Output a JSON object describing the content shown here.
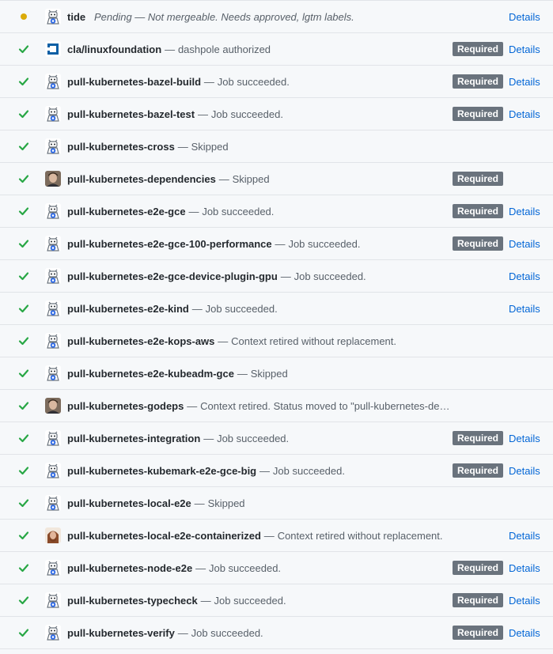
{
  "checks": [
    {
      "status": "pending",
      "avatar": "bot",
      "context": "tide",
      "separator": "",
      "description": "Pending — Not mergeable. Needs approved, lgtm labels.",
      "italic": true,
      "required": false,
      "details": "Details"
    },
    {
      "status": "success",
      "avatar": "linuxfoundation",
      "context": "cla/linuxfoundation",
      "separator": "—",
      "description": "dashpole authorized",
      "italic": false,
      "required": true,
      "details": "Details"
    },
    {
      "status": "success",
      "avatar": "bot",
      "context": "pull-kubernetes-bazel-build",
      "separator": "—",
      "description": "Job succeeded.",
      "italic": false,
      "required": true,
      "details": "Details"
    },
    {
      "status": "success",
      "avatar": "bot",
      "context": "pull-kubernetes-bazel-test",
      "separator": "—",
      "description": "Job succeeded.",
      "italic": false,
      "required": true,
      "details": "Details"
    },
    {
      "status": "success",
      "avatar": "bot",
      "context": "pull-kubernetes-cross",
      "separator": "—",
      "description": "Skipped",
      "italic": false,
      "required": false,
      "details": ""
    },
    {
      "status": "success",
      "avatar": "person1",
      "context": "pull-kubernetes-dependencies",
      "separator": "—",
      "description": "Skipped",
      "italic": false,
      "required": true,
      "details": ""
    },
    {
      "status": "success",
      "avatar": "bot",
      "context": "pull-kubernetes-e2e-gce",
      "separator": "—",
      "description": "Job succeeded.",
      "italic": false,
      "required": true,
      "details": "Details"
    },
    {
      "status": "success",
      "avatar": "bot",
      "context": "pull-kubernetes-e2e-gce-100-performance",
      "separator": "—",
      "description": "Job succeeded.",
      "italic": false,
      "required": true,
      "details": "Details"
    },
    {
      "status": "success",
      "avatar": "bot",
      "context": "pull-kubernetes-e2e-gce-device-plugin-gpu",
      "separator": "—",
      "description": "Job succeeded.",
      "italic": false,
      "required": false,
      "details": "Details"
    },
    {
      "status": "success",
      "avatar": "bot",
      "context": "pull-kubernetes-e2e-kind",
      "separator": "—",
      "description": "Job succeeded.",
      "italic": false,
      "required": false,
      "details": "Details"
    },
    {
      "status": "success",
      "avatar": "bot",
      "context": "pull-kubernetes-e2e-kops-aws",
      "separator": "—",
      "description": "Context retired without replacement.",
      "italic": false,
      "required": false,
      "details": ""
    },
    {
      "status": "success",
      "avatar": "bot",
      "context": "pull-kubernetes-e2e-kubeadm-gce",
      "separator": "—",
      "description": "Skipped",
      "italic": false,
      "required": false,
      "details": ""
    },
    {
      "status": "success",
      "avatar": "person1",
      "context": "pull-kubernetes-godeps",
      "separator": "—",
      "description": "Context retired. Status moved to \"pull-kubernetes-de…",
      "italic": false,
      "required": false,
      "details": ""
    },
    {
      "status": "success",
      "avatar": "bot",
      "context": "pull-kubernetes-integration",
      "separator": "—",
      "description": "Job succeeded.",
      "italic": false,
      "required": true,
      "details": "Details"
    },
    {
      "status": "success",
      "avatar": "bot",
      "context": "pull-kubernetes-kubemark-e2e-gce-big",
      "separator": "—",
      "description": "Job succeeded.",
      "italic": false,
      "required": true,
      "details": "Details"
    },
    {
      "status": "success",
      "avatar": "bot",
      "context": "pull-kubernetes-local-e2e",
      "separator": "—",
      "description": "Skipped",
      "italic": false,
      "required": false,
      "details": ""
    },
    {
      "status": "success",
      "avatar": "person2",
      "context": "pull-kubernetes-local-e2e-containerized",
      "separator": "—",
      "description": "Context retired without replacement.",
      "italic": false,
      "required": false,
      "details": "Details"
    },
    {
      "status": "success",
      "avatar": "bot",
      "context": "pull-kubernetes-node-e2e",
      "separator": "—",
      "description": "Job succeeded.",
      "italic": false,
      "required": true,
      "details": "Details"
    },
    {
      "status": "success",
      "avatar": "bot",
      "context": "pull-kubernetes-typecheck",
      "separator": "—",
      "description": "Job succeeded.",
      "italic": false,
      "required": true,
      "details": "Details"
    },
    {
      "status": "success",
      "avatar": "bot",
      "context": "pull-kubernetes-verify",
      "separator": "—",
      "description": "Job succeeded.",
      "italic": false,
      "required": true,
      "details": "Details"
    }
  ],
  "required_label": "Required",
  "colors": {
    "success": "#28a745",
    "pending": "#dbab09",
    "link": "#0366d6",
    "badge": "#6a737d"
  }
}
